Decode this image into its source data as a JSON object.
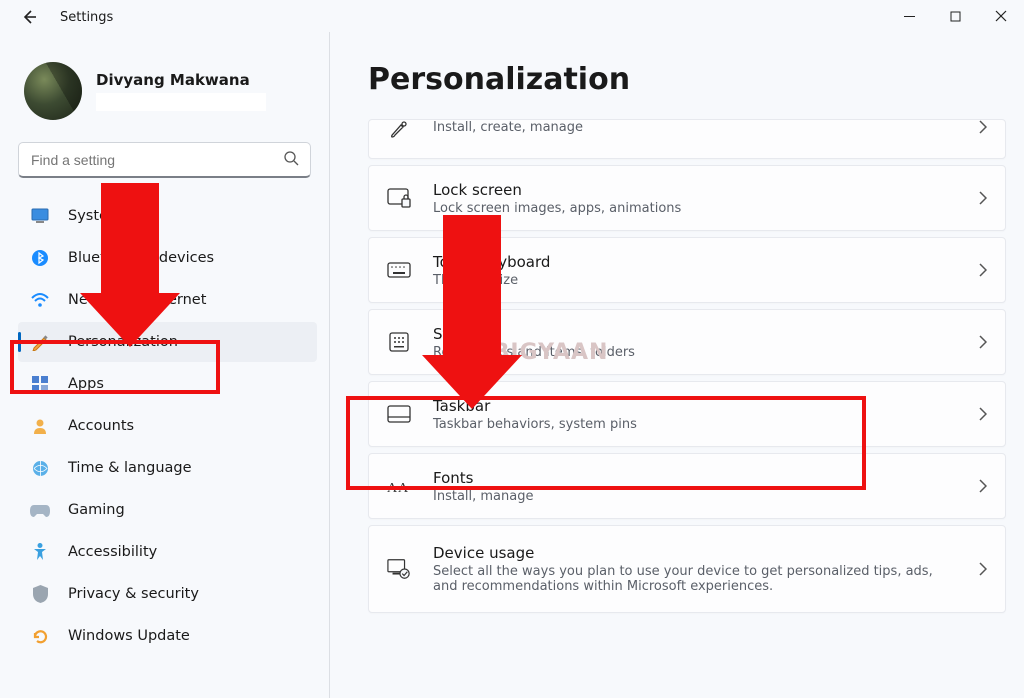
{
  "window": {
    "title": "Settings"
  },
  "user": {
    "name": "Divyang Makwana"
  },
  "search": {
    "placeholder": "Find a setting"
  },
  "sidebar": {
    "items": [
      {
        "icon": "system-icon",
        "label": "System"
      },
      {
        "icon": "bluetooth-icon",
        "label": "Bluetooth & devices"
      },
      {
        "icon": "network-icon",
        "label": "Network & internet"
      },
      {
        "icon": "personalization-icon",
        "label": "Personalization",
        "selected": true
      },
      {
        "icon": "apps-icon",
        "label": "Apps"
      },
      {
        "icon": "accounts-icon",
        "label": "Accounts"
      },
      {
        "icon": "time-icon",
        "label": "Time & language"
      },
      {
        "icon": "gaming-icon",
        "label": "Gaming"
      },
      {
        "icon": "accessibility-icon",
        "label": "Accessibility"
      },
      {
        "icon": "privacy-icon",
        "label": "Privacy & security"
      },
      {
        "icon": "update-icon",
        "label": "Windows Update"
      }
    ]
  },
  "page": {
    "title": "Personalization",
    "cards": [
      {
        "icon": "brush-icon",
        "title": "",
        "sub": "Install, create, manage",
        "partial": true
      },
      {
        "icon": "lockscreen-icon",
        "title": "Lock screen",
        "sub": "Lock screen images, apps, animations"
      },
      {
        "icon": "keyboard-icon",
        "title": "Touch keyboard",
        "sub": "Themes, size"
      },
      {
        "icon": "start-icon",
        "title": "Start",
        "sub": "Recent apps and items, folders"
      },
      {
        "icon": "taskbar-icon",
        "title": "Taskbar",
        "sub": "Taskbar behaviors, system pins"
      },
      {
        "icon": "fonts-icon",
        "title": "Fonts",
        "sub": "Install, manage"
      },
      {
        "icon": "device-usage-icon",
        "title": "Device usage",
        "sub": "Select all the ways you plan to use your device to get personalized tips, ads, and recommendations within Microsoft experiences."
      }
    ]
  },
  "watermark": "MOBIGYAAN"
}
